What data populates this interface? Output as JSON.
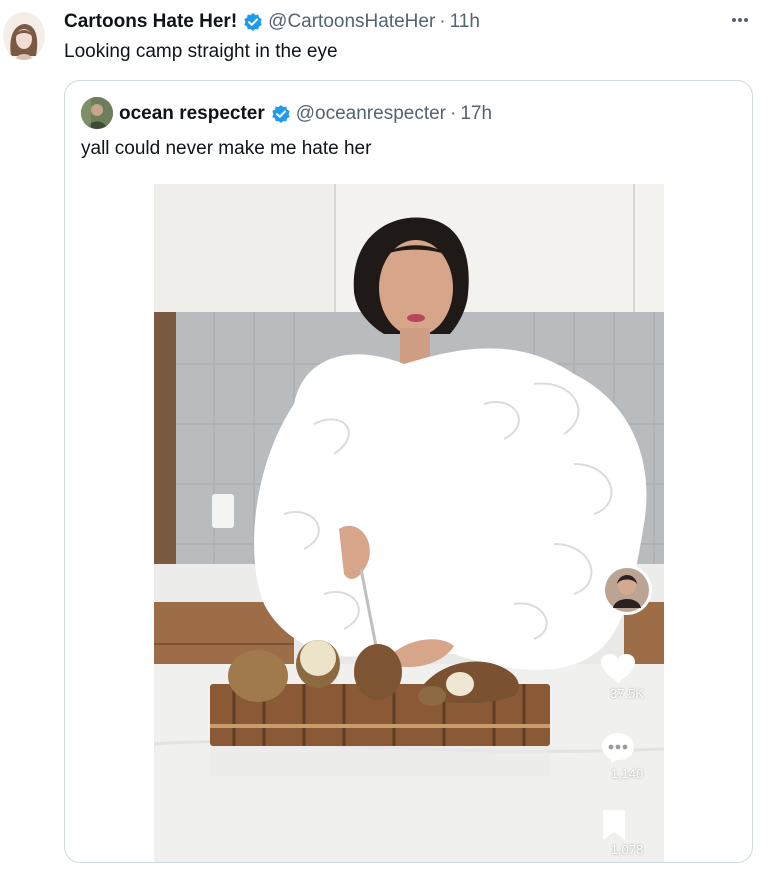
{
  "tweet": {
    "display_name": "Cartoons Hate Her!",
    "handle": "@CartoonsHateHer",
    "separator": "·",
    "time": "11h",
    "text": "Looking camp straight in the eye",
    "more_icon": "more-options-icon"
  },
  "quoted_tweet": {
    "display_name": "ocean respecter",
    "handle": "@oceanrespecter",
    "separator": "·",
    "time": "17h",
    "text": "yall could never make me hate her",
    "video_overlay": {
      "likes": "37.5K",
      "comments": "1,140",
      "saves": "1,078"
    }
  },
  "colors": {
    "verified_badge": "#1d9bf0",
    "text_primary": "#0f1419",
    "text_secondary": "#536471",
    "border": "#cfd9de"
  }
}
